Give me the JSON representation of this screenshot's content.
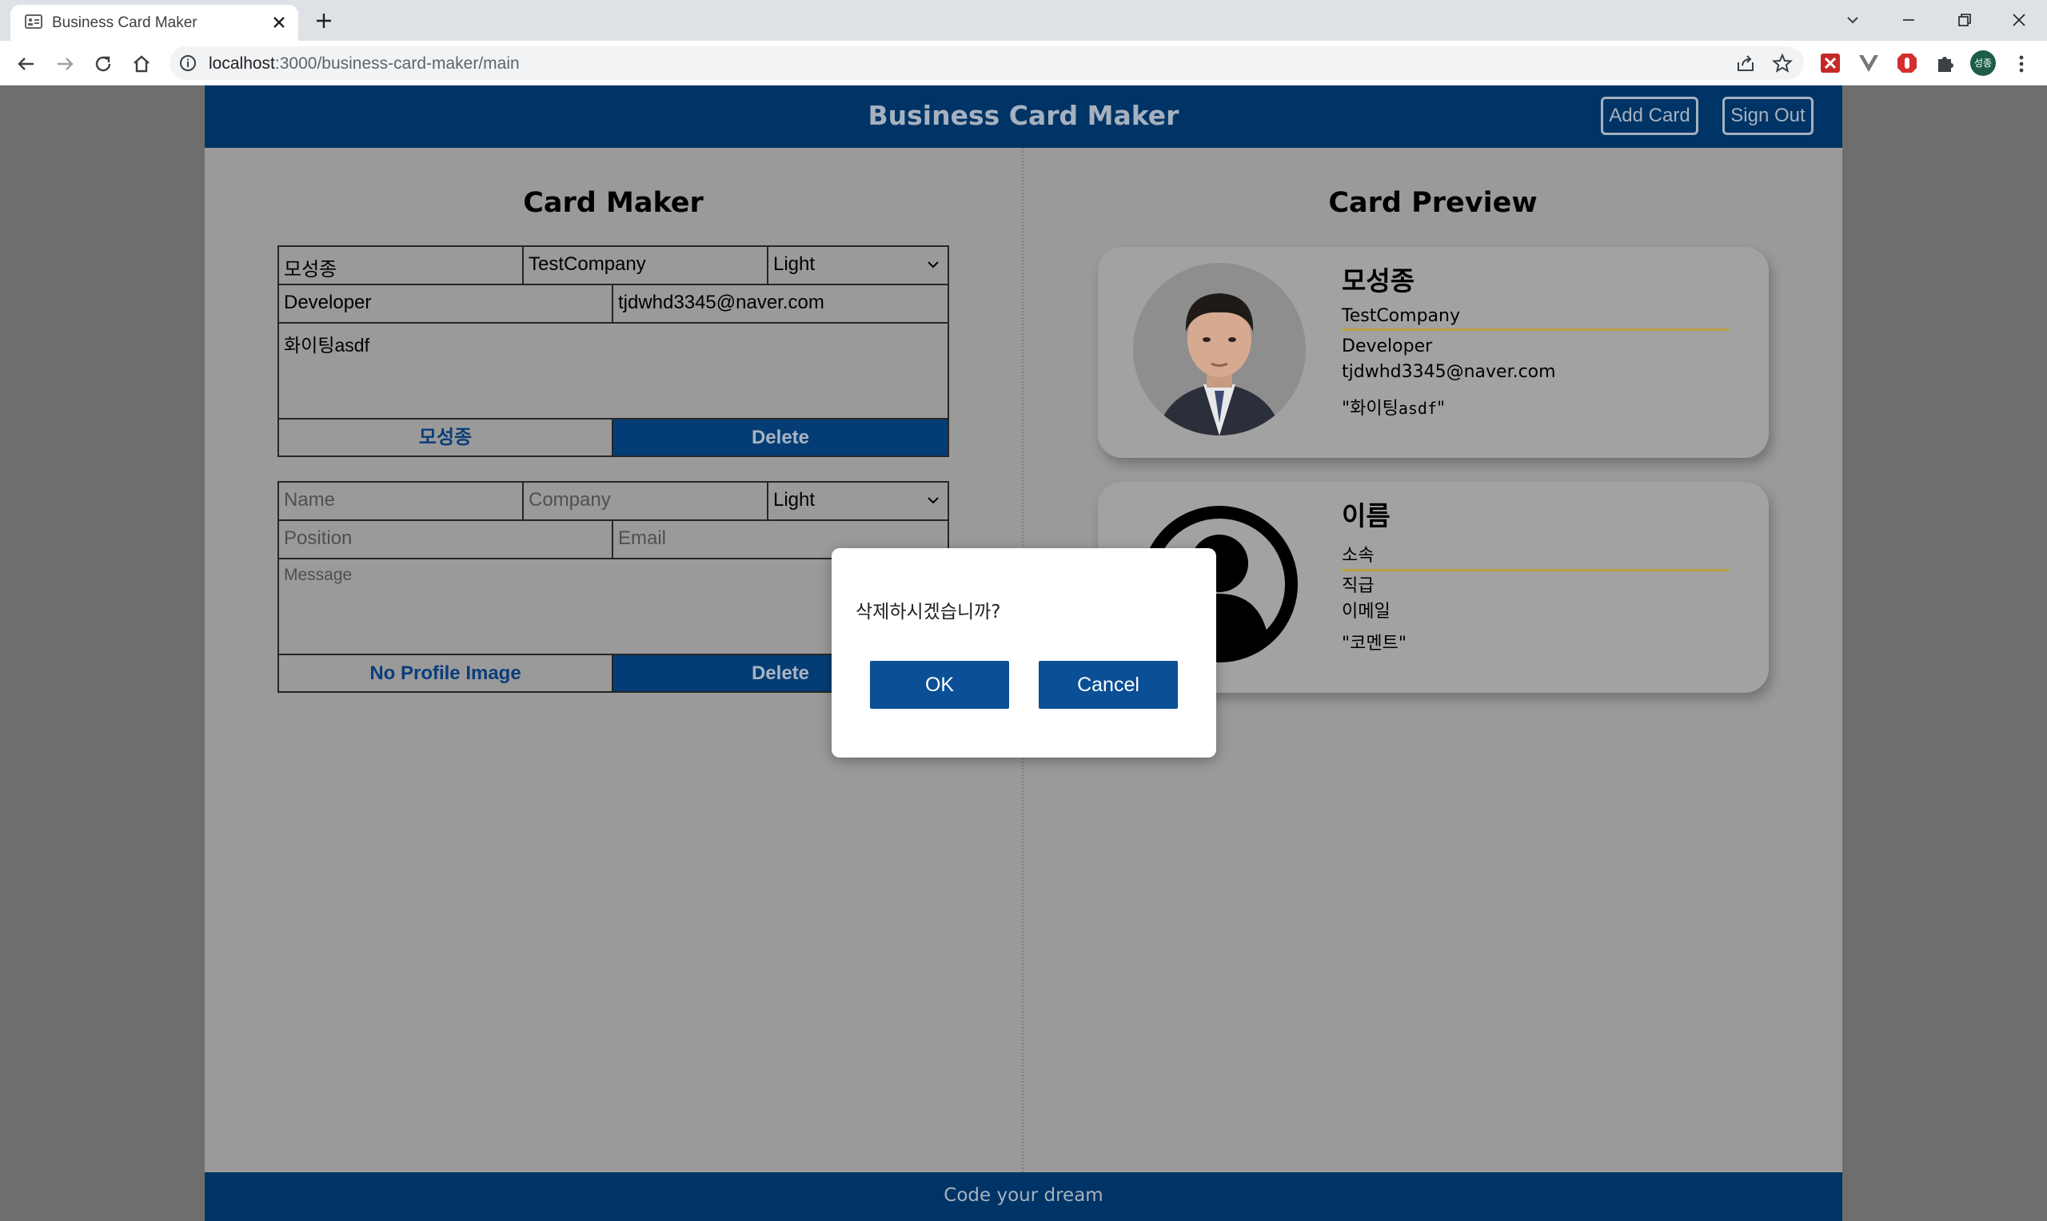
{
  "browser": {
    "tab_title": "Business Card Maker",
    "url_host": "localhost",
    "url_rest": ":3000/business-card-maker/main",
    "profile_initials": "성종"
  },
  "header": {
    "title": "Business Card Maker",
    "add_card": "Add Card",
    "sign_out": "Sign Out"
  },
  "maker": {
    "title": "Card Maker",
    "forms": [
      {
        "name": "모성종",
        "company": "TestCompany",
        "theme": "Light",
        "position": "Developer",
        "email": "tjdwhd3345@naver.com",
        "message": "화이팅asdf",
        "image_button": "모성종",
        "delete_button": "Delete"
      },
      {
        "name_placeholder": "Name",
        "company_placeholder": "Company",
        "theme": "Light",
        "position_placeholder": "Position",
        "email_placeholder": "Email",
        "message_placeholder": "Message",
        "image_button": "No Profile Image",
        "delete_button": "Delete"
      }
    ]
  },
  "preview": {
    "title": "Card Preview",
    "cards": [
      {
        "name": "모성종",
        "company": "TestCompany",
        "position": "Developer",
        "email": "tjdwhd3345@naver.com",
        "quote_open": "\"화이팅",
        "quote_mono": "asdf",
        "quote_close": "\""
      },
      {
        "name": "이름",
        "company": "소속",
        "position": "직급",
        "email": "이메일",
        "message": "\"코멘트\""
      }
    ]
  },
  "footer": {
    "text": "Code your dream"
  },
  "dialog": {
    "message": "삭제하시겠습니까?",
    "ok": "OK",
    "cancel": "Cancel"
  },
  "colors": {
    "header_bg": "#003466",
    "accent_button": "#0b4f96",
    "company_underline": "#bba045"
  }
}
